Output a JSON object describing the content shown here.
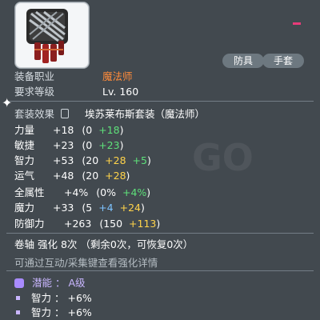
{
  "tags": [
    "防具",
    "手套"
  ],
  "info": {
    "job_label": "装备职业",
    "job_value": "魔法师",
    "level_label": "要求等级",
    "level_value": "Lv. 160"
  },
  "set": {
    "label": "套装效果",
    "name": "埃苏莱布斯套装（魔法师）"
  },
  "stats": [
    {
      "name": "力量",
      "total": "+18",
      "open": "(0",
      "base": "+18",
      "close": ")"
    },
    {
      "name": "敏捷",
      "total": "+23",
      "open": "(0",
      "base": "+23",
      "close": ")"
    },
    {
      "name": "智力",
      "total": "+53",
      "open": "(20",
      "base": "+28",
      "extra": "+5",
      "close": ")"
    },
    {
      "name": "运气",
      "total": "+48",
      "open": "(20",
      "base": "+28",
      "close": ")"
    },
    {
      "name": "全属性",
      "total": "+4%",
      "open": "(0%",
      "base": "+4%",
      "close": ")"
    },
    {
      "name": "魔力",
      "total": "+33",
      "open": "(5",
      "base": "+4",
      "extra": "+24",
      "close": ")"
    },
    {
      "name": "防御力",
      "total": "+263",
      "open": "(150",
      "base": "+113",
      "close": ")"
    }
  ],
  "scroll": {
    "text": "卷轴 强化 8次 （剩余0次，可恢复0次）"
  },
  "hint": "可通过互动/采集键查看强化详情",
  "potential": {
    "label": "潜能",
    "sep": "：",
    "grade": "A级",
    "lines": [
      {
        "name": "智力",
        "sep": "：",
        "value": "+6%"
      },
      {
        "name": "智力",
        "sep": "：",
        "value": "+6%"
      }
    ]
  },
  "colors": {
    "job_value": "#ff8b3a",
    "green_stat": "#5ee07a",
    "yellow_stat": "#ffd34a",
    "potential": "#c9b6ff"
  },
  "icons": {
    "item": "glove-icon",
    "set": "lock-icon",
    "potential": "potential-icon"
  }
}
